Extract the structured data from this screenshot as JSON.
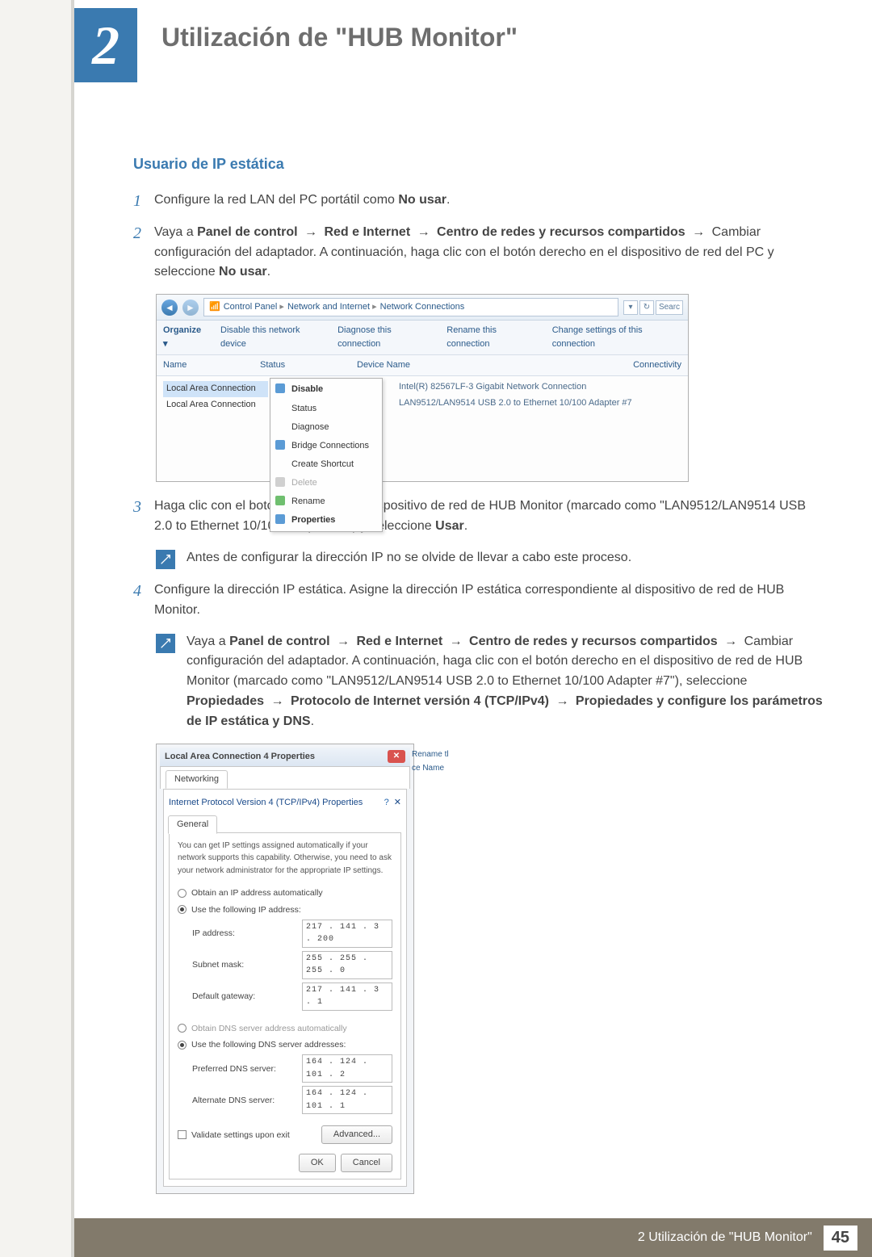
{
  "chapter_number": "2",
  "page_title": "Utilización de \"HUB Monitor\"",
  "section_heading": "Usuario de IP estática",
  "steps": {
    "s1": {
      "num": "1",
      "text_a": "Configure la red LAN del PC portátil como ",
      "bold_a": "No usar",
      "text_b": "."
    },
    "s2": {
      "num": "2",
      "text_a": "Vaya a ",
      "bold_a": "Panel de control",
      "bold_b": "Red e Internet",
      "bold_c": "Centro de redes y recursos compartidos",
      "text_b": "Cambiar configuración del adaptador. A continuación, haga clic con el botón derecho en el dispositivo de red del PC y seleccione ",
      "bold_d": "No usar",
      "text_c": "."
    },
    "s3": {
      "num": "3",
      "text_a": "Haga clic con el botón derecho en el dispositivo de red de HUB Monitor (marcado como \"LAN9512/LAN9514 USB 2.0 to Ethernet 10/100 Adapter #7\") y seleccione ",
      "bold_a": "Usar",
      "text_b": "."
    },
    "s4": {
      "num": "4",
      "text_a": "Configure la dirección IP estática. Asigne la dirección IP estática correspondiente al dispositivo de red de HUB Monitor."
    }
  },
  "note1": "Antes de configurar la dirección IP no se olvide de llevar a cabo este proceso.",
  "note2": {
    "text_a": "Vaya a ",
    "bold_a": "Panel de control",
    "bold_b": "Red e Internet",
    "bold_c": "Centro de redes y recursos compartidos",
    "text_b": "Cambiar configuración del adaptador. A continuación, haga clic con el botón derecho en el dispositivo de red de HUB Monitor (marcado como \"LAN9512/LAN9514 USB 2.0 to Ethernet 10/100 Adapter #7\"), seleccione ",
    "bold_d": "Propiedades",
    "bold_e": "Protocolo de Internet versión 4 (TCP/IPv4)",
    "bold_f": "Propiedades y configure los parámetros de IP estática y DNS",
    "text_c": "."
  },
  "win1": {
    "breadcrumb": [
      "Control Panel",
      "Network and Internet",
      "Network Connections"
    ],
    "search_label": "Searc",
    "bullets": [
      "▾",
      "↻"
    ],
    "menu": {
      "organize": "Organize ▾",
      "disable": "Disable this network device",
      "diagnose": "Diagnose this connection",
      "rename": "Rename this connection",
      "change": "Change settings of this connection"
    },
    "cols": {
      "name": "Name",
      "status": "Status",
      "device": "Device Name",
      "conn": "Connectivity"
    },
    "items": [
      {
        "label": "Local Area Connection",
        "device": "Intel(R) 82567LF-3 Gigabit Network Connection"
      },
      {
        "label": "Local Area Connection",
        "device": "LAN9512/LAN9514 USB 2.0 to Ethernet 10/100 Adapter #7"
      }
    ],
    "ctx": [
      "Disable",
      "Status",
      "Diagnose",
      "Bridge Connections",
      "Create Shortcut",
      "Delete",
      "Rename",
      "Properties"
    ]
  },
  "win2": {
    "outer_title": "Local Area Connection 4 Properties",
    "outer_tab": "Networking",
    "inner_title": "Internet Protocol Version 4 (TCP/IPv4) Properties",
    "inner_tab": "General",
    "desc": "You can get IP settings assigned automatically if your network supports this capability. Otherwise, you need to ask your network administrator for the appropriate IP settings.",
    "radio_auto_ip": "Obtain an IP address automatically",
    "radio_use_ip": "Use the following IP address:",
    "fields_ip": {
      "ip_label": "IP address:",
      "ip_val": "217 . 141 .  3  . 200",
      "mask_label": "Subnet mask:",
      "mask_val": "255 . 255 . 255 .  0",
      "gw_label": "Default gateway:",
      "gw_val": "217 . 141 .  3  .  1"
    },
    "radio_auto_dns": "Obtain DNS server address automatically",
    "radio_use_dns": "Use the following DNS server addresses:",
    "fields_dns": {
      "pref_label": "Preferred DNS server:",
      "pref_val": "164 . 124 . 101 .  2",
      "alt_label": "Alternate DNS server:",
      "alt_val": "164 . 124 . 101 .  1"
    },
    "validate": "Validate settings upon exit",
    "btn_advanced": "Advanced...",
    "btn_ok": "OK",
    "btn_cancel": "Cancel",
    "side_stub": {
      "rename": "Rename tl",
      "iname": "ce Name",
      "xicon": "✕"
    }
  },
  "footer": {
    "text": "2 Utilización de \"HUB Monitor\"",
    "page_no": "45"
  },
  "arrow": "→"
}
